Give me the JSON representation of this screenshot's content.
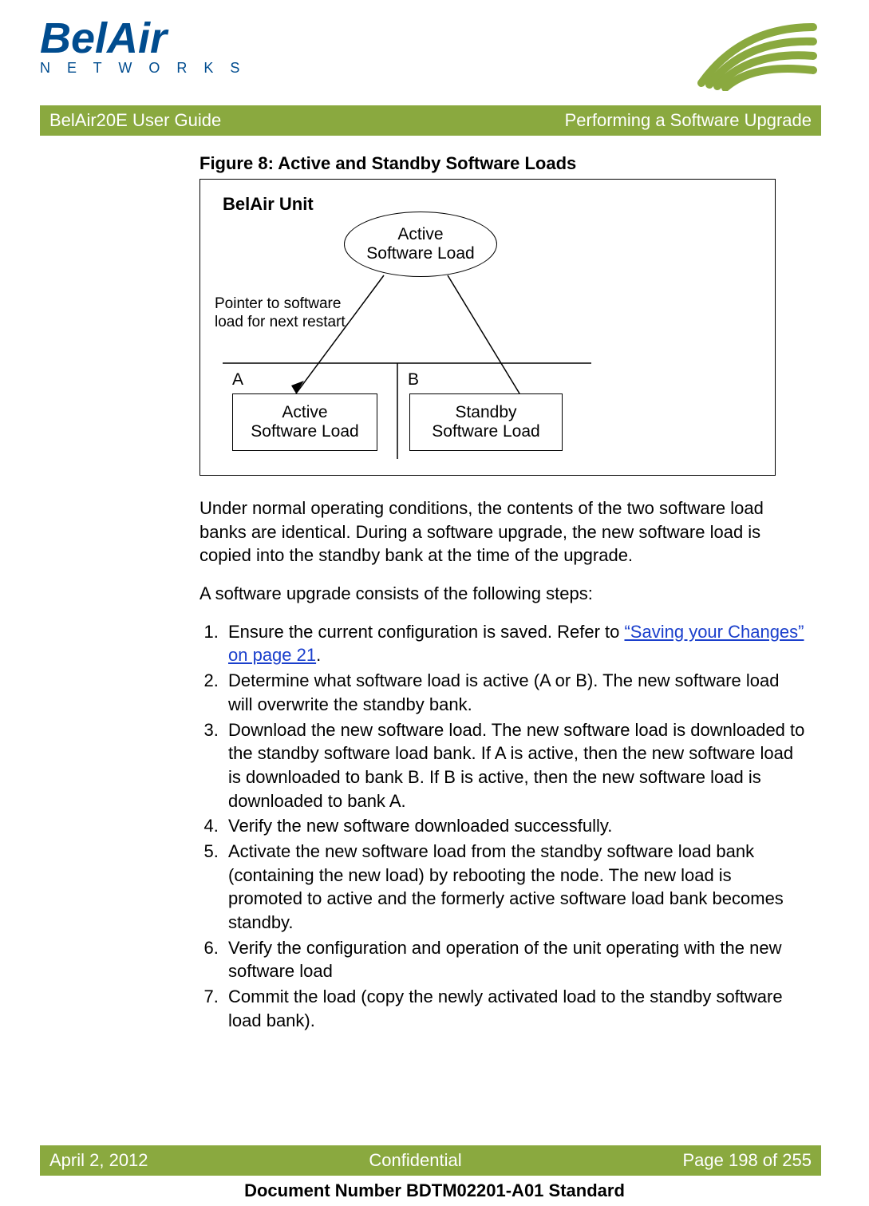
{
  "brand": {
    "name": "BelAir",
    "sub": "N E T W O R K S"
  },
  "banner": {
    "left": "BelAir20E User Guide",
    "right": "Performing a Software Upgrade"
  },
  "figure": {
    "caption": "Figure 8: Active and Standby Software Loads",
    "unit_label": "BelAir Unit",
    "pointer_label_l1": "Pointer to software",
    "pointer_label_l2": "load for next restart",
    "ell_l1": "Active",
    "ell_l2": "Software Load",
    "labelA": "A",
    "labelB": "B",
    "boxA_l1": "Active",
    "boxA_l2": "Software Load",
    "boxB_l1": "Standby",
    "boxB_l2": "Software Load"
  },
  "para1": "Under normal operating conditions, the contents of the two software load banks are identical. During a software upgrade, the new software load is copied into the standby bank at the time of the upgrade.",
  "para2": "A software upgrade consists of the following steps:",
  "steps": {
    "s1a": "Ensure the current configuration is saved. Refer to ",
    "s1link": "“Saving your Changes” on page 21",
    "s1b": ".",
    "s2": "Determine what software load is active (A or B). The new software load will overwrite the standby bank.",
    "s3": "Download the new software load. The new software load is downloaded to the standby software load bank. If A is active, then the new software load is downloaded to bank B. If B is active, then the new software load is downloaded to bank A.",
    "s4": "Verify the new software downloaded successfully.",
    "s5": "Activate the new software load from the standby software load bank (containing the new load) by rebooting the node. The new load is promoted to active and the formerly active software load bank becomes standby.",
    "s6": "Verify the configuration and operation of the unit operating with the new software load",
    "s7": "Commit the load (copy the newly activated load to the standby software load bank)."
  },
  "footer": {
    "date": "April 2, 2012",
    "conf": "Confidential",
    "page": "Page 198 of 255",
    "docnum": "Document Number BDTM02201-A01 Standard"
  }
}
